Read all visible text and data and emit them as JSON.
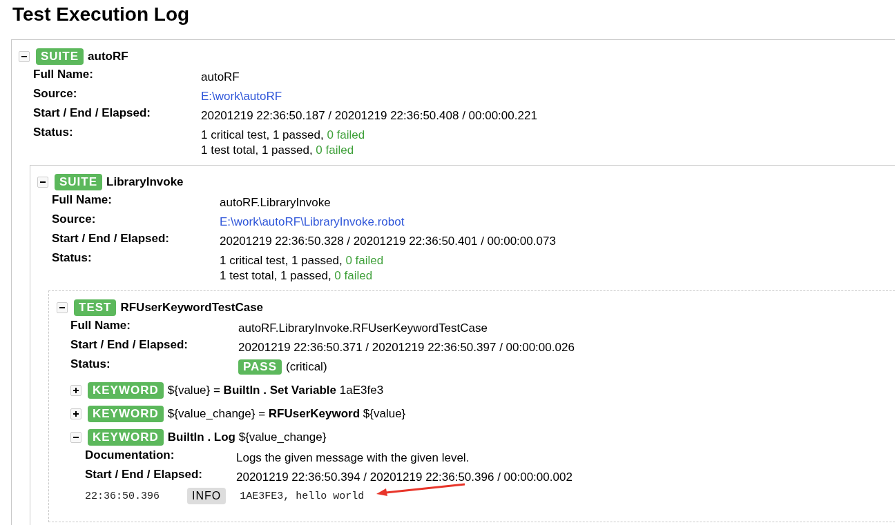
{
  "title": "Test Execution Log",
  "root": {
    "kind": "suite",
    "label": "SUITE",
    "expanded": true,
    "name": "autoRF",
    "metadata": [
      {
        "label": "Full Name:",
        "kind": "text",
        "value": "autoRF"
      },
      {
        "label": "Source:",
        "kind": "link",
        "value": "E:\\work\\autoRF"
      },
      {
        "label": "Start / End / Elapsed:",
        "kind": "text",
        "value": "20201219 22:36:50.187 / 20201219 22:36:50.408 / 00:00:00.221"
      },
      {
        "label": "Status:",
        "kind": "counts",
        "lines": [
          {
            "text": "1 critical test, 1 passed, ",
            "failed": "0 failed"
          },
          {
            "text": "1 test total, 1 passed, ",
            "failed": "0 failed"
          }
        ]
      }
    ],
    "children": [
      {
        "kind": "suite",
        "label": "SUITE",
        "expanded": true,
        "name": "LibraryInvoke",
        "metadata": [
          {
            "label": "Full Name:",
            "kind": "text",
            "value": "autoRF.LibraryInvoke"
          },
          {
            "label": "Source:",
            "kind": "link",
            "value": "E:\\work\\autoRF\\LibraryInvoke.robot"
          },
          {
            "label": "Start / End / Elapsed:",
            "kind": "text",
            "value": "20201219 22:36:50.328 / 20201219 22:36:50.401 / 00:00:00.073"
          },
          {
            "label": "Status:",
            "kind": "counts",
            "lines": [
              {
                "text": "1 critical test, 1 passed, ",
                "failed": "0 failed"
              },
              {
                "text": "1 test total, 1 passed, ",
                "failed": "0 failed"
              }
            ]
          }
        ],
        "children": [
          {
            "kind": "test",
            "label": "TEST",
            "expanded": true,
            "name": "RFUserKeywordTestCase",
            "metadata": [
              {
                "label": "Full Name:",
                "kind": "text",
                "value": "autoRF.LibraryInvoke.RFUserKeywordTestCase"
              },
              {
                "label": "Start / End / Elapsed:",
                "kind": "text",
                "value": "20201219 22:36:50.371 / 20201219 22:36:50.397 / 00:00:00.026"
              },
              {
                "label": "Status:",
                "kind": "status",
                "badge": "PASS",
                "note": "(critical)"
              }
            ],
            "children": [
              {
                "kind": "keyword",
                "label": "KEYWORD",
                "expanded": false,
                "name": "${value} = **BuiltIn . Set Variable** 1aE3fe3"
              },
              {
                "kind": "keyword",
                "label": "KEYWORD",
                "expanded": false,
                "name": "${value_change} = **RFUserKeyword** ${value}"
              },
              {
                "kind": "keyword",
                "label": "KEYWORD",
                "expanded": true,
                "name": "**BuiltIn . Log** ${value_change}",
                "metadata": [
                  {
                    "label": "Documentation:",
                    "kind": "text",
                    "value": "Logs the given message with the given level."
                  },
                  {
                    "label": "Start / End / Elapsed:",
                    "kind": "text",
                    "value": "20201219 22:36:50.394 / 20201219 22:36:50.396 / 00:00:00.002"
                  }
                ],
                "messages": [
                  {
                    "time": "22:36:50.396",
                    "level": "INFO",
                    "text": "1AE3FE3, hello world"
                  }
                ]
              }
            ]
          }
        ]
      }
    ]
  }
}
